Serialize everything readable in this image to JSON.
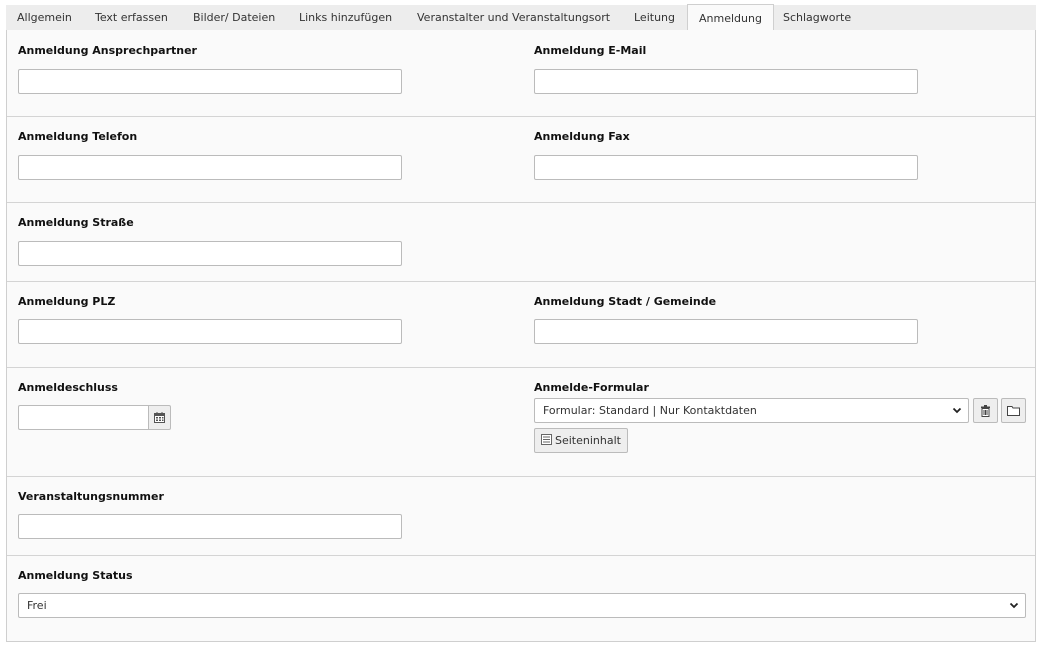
{
  "tabs": [
    {
      "label": "Allgemein"
    },
    {
      "label": "Text erfassen"
    },
    {
      "label": "Bilder/ Dateien"
    },
    {
      "label": "Links hinzufügen"
    },
    {
      "label": "Veranstalter und Veranstaltungsort"
    },
    {
      "label": "Leitung"
    },
    {
      "label": "Anmeldung"
    },
    {
      "label": "Schlagworte"
    }
  ],
  "fields": {
    "contact_person": {
      "label": "Anmeldung Ansprechpartner",
      "value": ""
    },
    "email": {
      "label": "Anmeldung E-Mail",
      "value": ""
    },
    "phone": {
      "label": "Anmeldung Telefon",
      "value": ""
    },
    "fax": {
      "label": "Anmeldung Fax",
      "value": ""
    },
    "street": {
      "label": "Anmeldung Straße",
      "value": ""
    },
    "zip": {
      "label": "Anmeldung PLZ",
      "value": ""
    },
    "city": {
      "label": "Anmeldung Stadt / Gemeinde",
      "value": ""
    },
    "deadline": {
      "label": "Anmeldeschluss",
      "value": ""
    },
    "form": {
      "label": "Anmelde-Formular",
      "selected": "Formular: Standard | Nur Kontaktdaten",
      "content_button": "Seiteninhalt"
    },
    "event_number": {
      "label": "Veranstaltungsnummer",
      "value": ""
    },
    "status": {
      "label": "Anmeldung Status",
      "selected": "Frei"
    }
  }
}
